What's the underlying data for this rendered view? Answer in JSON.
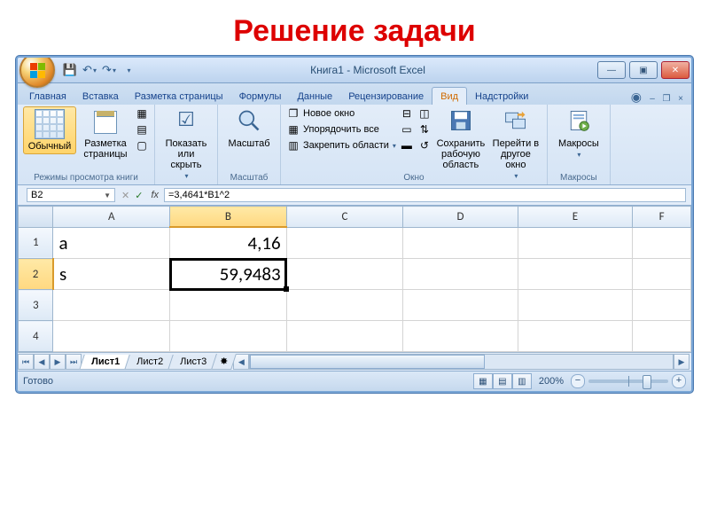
{
  "page": {
    "title": "Решение задачи"
  },
  "window": {
    "title": "Книга1 - Microsoft Excel"
  },
  "qat": {
    "save": "💾",
    "undo": "↶",
    "redo": "↷"
  },
  "tabs": {
    "items": [
      "Главная",
      "Вставка",
      "Разметка страницы",
      "Формулы",
      "Данные",
      "Рецензирование",
      "Вид",
      "Надстройки"
    ],
    "active_index": 6
  },
  "ribbon": {
    "views_group": "Режимы просмотра книги",
    "normal": "Обычный",
    "page_layout": "Разметка страницы",
    "show_hide": "Показать или скрыть",
    "zoom_group": "Масштаб",
    "zoom": "Масштаб",
    "new_window": "Новое окно",
    "arrange_all": "Упорядочить все",
    "freeze_panes": "Закрепить области",
    "window_group": "Окно",
    "save_workspace": "Сохранить рабочую область",
    "switch_windows": "Перейти в другое окно",
    "macros": "Макросы",
    "macros_group": "Макросы"
  },
  "namebox": {
    "value": "B2"
  },
  "formula": {
    "value": "=3,4641*B1^2"
  },
  "columns": [
    "A",
    "B",
    "C",
    "D",
    "E",
    "F"
  ],
  "rows": [
    "1",
    "2",
    "3",
    "4"
  ],
  "cells": {
    "A1": "a",
    "B1": "4,16",
    "A2": "s",
    "B2": "59,9483"
  },
  "sheets": {
    "items": [
      "Лист1",
      "Лист2",
      "Лист3"
    ],
    "active_index": 0
  },
  "status": {
    "ready": "Готово",
    "zoom": "200%"
  },
  "nav": {
    "first": "⏮",
    "prev": "◀",
    "next": "▶",
    "last": "⏭"
  }
}
